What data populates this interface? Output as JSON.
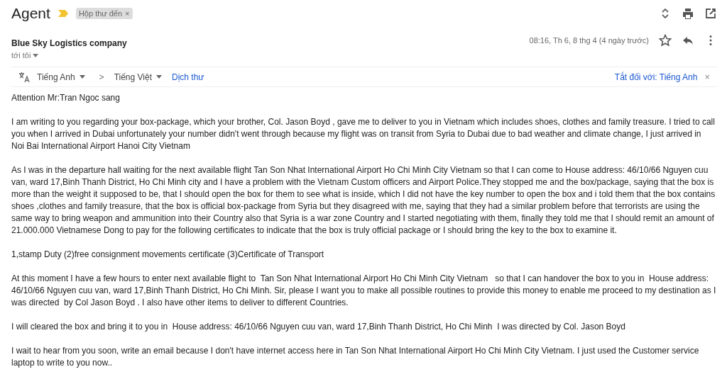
{
  "header": {
    "subject": "Agent",
    "important": true,
    "labels": [
      {
        "text": "Hộp thư đến",
        "close": "×"
      }
    ]
  },
  "message": {
    "sender": "Blue Sky Logistics company",
    "recipient": "tới tôi",
    "date": "08:16, Th 6, 8 thg 4 (4 ngày trước)",
    "starred": false
  },
  "translate": {
    "source_language": "Tiếng Anh",
    "separator": ">",
    "target_language": "Tiếng Việt",
    "action": "Dịch thư",
    "turn_off": "Tắt đối với: Tiếng Anh",
    "close": "×"
  },
  "body": {
    "paragraphs": [
      "Attention Mr:Tran Ngoc sang",
      "I am writing to you regarding your box-package, which your brother, Col. Jason Boyd , gave me to deliver to you in Vietnam which includes shoes, clothes and family treasure. I tried to call you when I arrived in Dubai unfortunately your number didn't went through because my flight was on transit from Syria to Dubai due to bad weather and climate change, I just arrived in  Noi Bai International Airport Hanoi City Vietnam",
      "As I was in the departure hall waiting for the next available flight Tan Son Nhat International Airport Ho Chi Minh City Vietnam so that I can come to House address: 46/10/66 Nguyen cuu van, ward 17,Binh Thanh District, Ho Chi Minh city and I have a problem with the Vietnam Custom officers and Airport Police.They stopped me and the box/package, saying that the box is more than the weight it supposed to be, that I should open the box for them to see what is inside, which I did not have the key number to open the box and i told them that the box contains shoes ,clothes and family treasure, that the box is official box-package from Syria but they disagreed with me, saying that they had a similar problem before that terrorists are using the same way to bring weapon and ammunition into their Country also that Syria is a war zone Country and I started negotiating with them, finally they told me that I should remit an amount of 21.000.000 Vietnamese Dong to pay for the following certificates to indicate that the box is truly official package or I should bring the key to the box to examine it.",
      "1,stamp Duty (2)free consignment movements certificate (3)Certificate of Transport",
      "At this moment I have a few hours to enter next available flight to  Tan Son Nhat International Airport Ho Chi Minh City Vietnam   so that I can handover the box to you in  House address: 46/10/66 Nguyen cuu van, ward 17,Binh Thanh District, Ho Chi Minh. Sir, please I want you to make all possible routines to provide this money to enable me proceed to my destination as I was directed  by Col Jason Boyd . I also have other items to deliver to different Countries.",
      "I will cleared the box and bring it to you in  House address: 46/10/66 Nguyen cuu van, ward 17,Binh Thanh District, Ho Chi Minh  I was directed by Col. Jason Boyd",
      "I wait to hear from you soon, write an email because I don't have internet access here in Tan Son Nhat International Airport Ho Chi Minh City Vietnam. I just used the Customer service laptop to write to you now.."
    ]
  }
}
